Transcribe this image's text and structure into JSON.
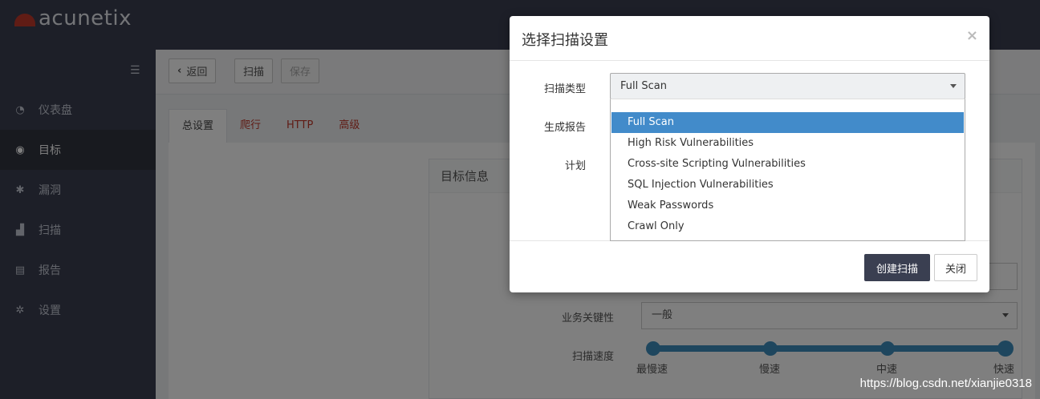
{
  "app": {
    "logo_text": "acunetix"
  },
  "sidebar": {
    "items": [
      {
        "label": "仪表盘",
        "icon": "dashboard-icon"
      },
      {
        "label": "目标",
        "icon": "target-icon"
      },
      {
        "label": "漏洞",
        "icon": "bug-icon"
      },
      {
        "label": "扫描",
        "icon": "chart-icon"
      },
      {
        "label": "报告",
        "icon": "report-icon"
      },
      {
        "label": "设置",
        "icon": "gear-icon"
      }
    ],
    "active": "目标"
  },
  "toolbar": {
    "back_label": "返回",
    "scan_label": "扫描",
    "save_label": "保存"
  },
  "tabs": [
    "总设置",
    "爬行",
    "HTTP",
    "高级"
  ],
  "panel": {
    "title": "目标信息",
    "criticality_label": "业务关键性",
    "criticality_value": "一般",
    "speed_label": "扫描速度",
    "speed_levels": [
      "最慢速",
      "慢速",
      "中速",
      "快速"
    ]
  },
  "modal": {
    "title": "选择扫描设置",
    "close_glyph": "×",
    "scan_type_label": "扫描类型",
    "scan_type_value": "Full Scan",
    "report_label": "生成报告",
    "schedule_label": "计划",
    "options": [
      "Full Scan",
      "High Risk Vulnerabilities",
      "Cross-site Scripting Vulnerabilities",
      "SQL Injection Vulnerabilities",
      "Weak Passwords",
      "Crawl Only"
    ],
    "selected_option": "Full Scan",
    "create_button": "创建扫描",
    "close_button": "关闭"
  },
  "watermark": "https://blog.csdn.net/xianjie0318"
}
